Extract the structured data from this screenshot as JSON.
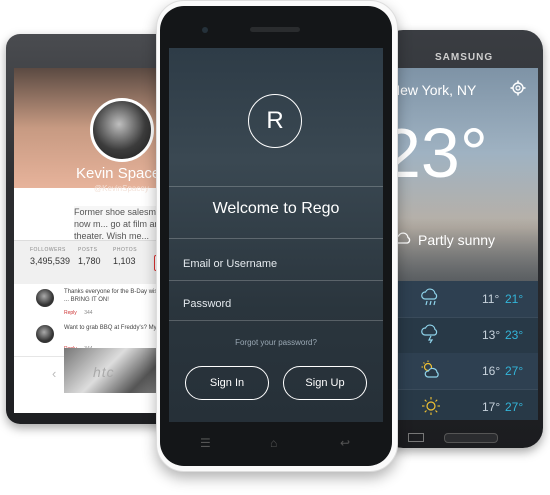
{
  "htc": {
    "brand": "htc",
    "nav_back": "‹",
    "profile": {
      "name": "Kevin Spacey",
      "handle": "@KevinSpacey",
      "bio": "Former shoe salesman now m... go at film and theater. Wish me..."
    },
    "stats": [
      {
        "label": "FOLLOWERS",
        "value": "3,495,539"
      },
      {
        "label": "POSTS",
        "value": "1,780"
      },
      {
        "label": "PHOTOS",
        "value": "1,103"
      }
    ],
    "tweets": [
      {
        "text": "Thanks everyone for the B-Day wishes. ... BRING IT ON!",
        "reply": "Reply",
        "count": "344"
      },
      {
        "text": "Want to grab BBQ at Freddy's? My treat",
        "reply": "Reply",
        "count": "344"
      }
    ]
  },
  "rego": {
    "logo_letter": "R",
    "welcome": "Welcome to Rego",
    "username_placeholder": "Email or Username",
    "password_placeholder": "Password",
    "forgot": "Forgot your password?",
    "sign_in": "Sign In",
    "sign_up": "Sign Up",
    "nav": {
      "menu": "☰",
      "home": "⌂",
      "back": "↩"
    }
  },
  "samsung": {
    "brand": "SAMSUNG",
    "city": "New York, NY",
    "temp": "23°",
    "condition": "Partly sunny",
    "forecast": [
      {
        "icon": "rain-cloud-icon",
        "low": "11°",
        "high": "21°"
      },
      {
        "icon": "storm-cloud-icon",
        "low": "13°",
        "high": "23°"
      },
      {
        "icon": "partly-cloudy-icon",
        "low": "16°",
        "high": "27°"
      },
      {
        "icon": "sun-icon",
        "low": "17°",
        "high": "27°"
      }
    ],
    "colors": {
      "high_temp": "#33b5d9"
    }
  }
}
